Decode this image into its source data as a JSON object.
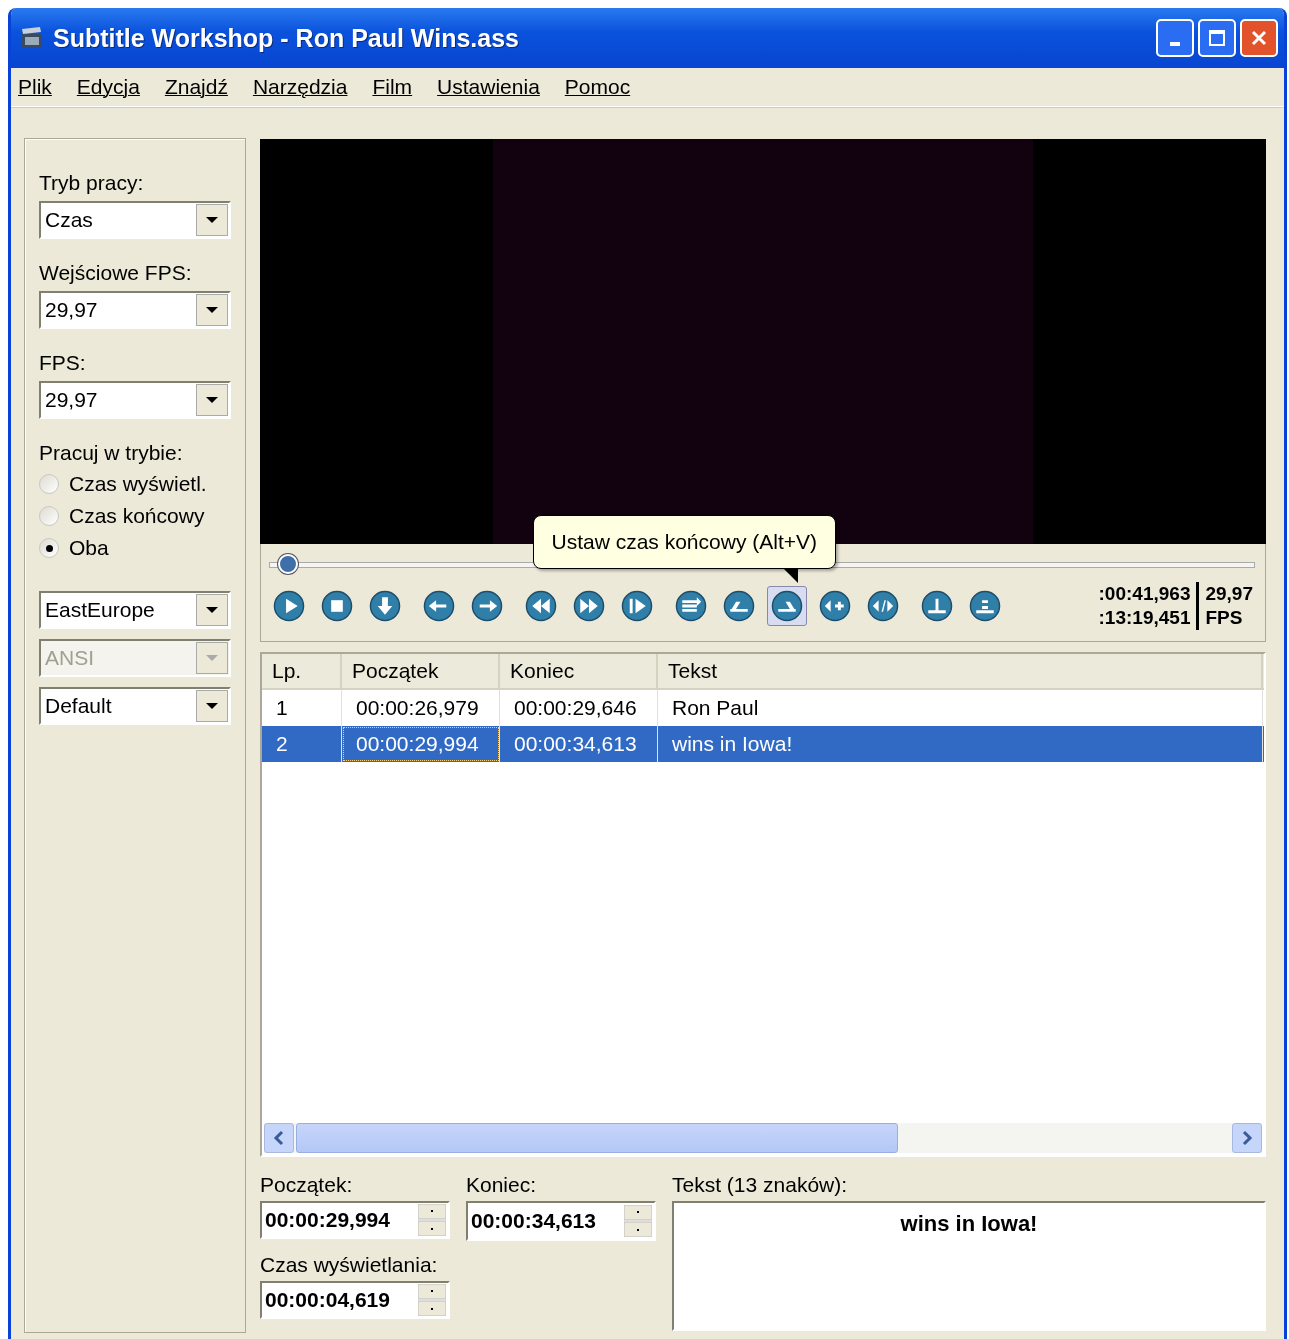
{
  "window": {
    "title": "Subtitle Workshop - Ron Paul Wins.ass"
  },
  "menu": [
    "Plik",
    "Edycja",
    "Znajdź",
    "Narzędzia",
    "Film",
    "Ustawienia",
    "Pomoc"
  ],
  "sidebar": {
    "mode": {
      "label": "Tryb pracy:",
      "value": "Czas",
      "disabled": false
    },
    "input_fps": {
      "label": "Wejściowe FPS:",
      "value": "29,97",
      "disabled": false
    },
    "fps": {
      "label": "FPS:",
      "value": "29,97",
      "disabled": false
    },
    "work_mode": {
      "label": "Pracuj w trybie:",
      "options": [
        {
          "label": "Czas wyświetl.",
          "selected": false
        },
        {
          "label": "Czas końcowy",
          "selected": false
        },
        {
          "label": "Oba",
          "selected": true
        }
      ]
    },
    "dropdowns": [
      {
        "value": "EastEurope",
        "disabled": false
      },
      {
        "value": "ANSI",
        "disabled": true
      },
      {
        "value": "Default",
        "disabled": false
      }
    ]
  },
  "player": {
    "seek": {
      "level": 0.01
    },
    "toolbar_groups": [
      [
        {
          "hovered": false
        },
        {
          "hovered": false
        },
        {
          "hovered": false
        }
      ],
      [
        {
          "hovered": false
        },
        {
          "hovered": false
        }
      ],
      [
        {
          "hovered": false
        },
        {
          "hovered": false
        },
        {
          "hovered": false
        }
      ],
      [
        {
          "hovered": false
        },
        {
          "hovered": false
        },
        {
          "hovered": true
        },
        {
          "hovered": false
        },
        {
          "hovered": false
        }
      ],
      [
        {
          "hovered": false
        },
        {
          "hovered": false
        }
      ]
    ],
    "tooltip": "Ustaw czas końcowy (Alt+V)",
    "position": ":00:41,963",
    "length": ":13:19,451",
    "fps_value": "29,97",
    "fps_label": "FPS"
  },
  "table": {
    "columns": [
      "Lp.",
      "Początek",
      "Koniec",
      "Tekst"
    ],
    "rows": [
      {
        "cells": [
          "1",
          "00:00:26,979",
          "00:00:29,646",
          "Ron Paul"
        ],
        "selected": false
      },
      {
        "cells": [
          "2",
          "00:00:29,994",
          "00:00:34,613",
          "wins in Iowa!"
        ],
        "selected": true
      }
    ]
  },
  "editor": {
    "start": {
      "label": "Początek:",
      "value": "00:00:29,994"
    },
    "end": {
      "label": "Koniec:",
      "value": "00:00:34,613"
    },
    "duration": {
      "label": "Czas wyświetlania:",
      "value": "00:00:04,619"
    },
    "text": {
      "label": "Tekst (13 znaków):",
      "value": "wins in Iowa!"
    }
  }
}
